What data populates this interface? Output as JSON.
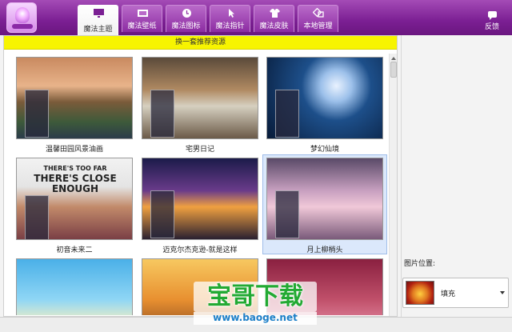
{
  "header": {
    "tabs": [
      {
        "label": "魔法主题",
        "icon": "monitor-icon",
        "active": true
      },
      {
        "label": "魔法壁纸",
        "icon": "wallpaper-icon",
        "active": false
      },
      {
        "label": "魔法图标",
        "icon": "clock-icon",
        "active": false
      },
      {
        "label": "魔法指针",
        "icon": "cursor-icon",
        "active": false
      },
      {
        "label": "魔法皮肤",
        "icon": "shirt-icon",
        "active": false
      },
      {
        "label": "本地管理",
        "icon": "manage-icon",
        "active": false
      }
    ],
    "feedback_label": "反馈"
  },
  "content": {
    "banner_text": "换一套推荐资源",
    "themes": [
      {
        "name": "温馨田园风景油画"
      },
      {
        "name": "宅男日记"
      },
      {
        "name": "梦幻仙境"
      },
      {
        "name": "初音未来二"
      },
      {
        "name": "迈克尔杰克逊-就是这样"
      },
      {
        "name": "月上柳梢头"
      },
      {
        "name": ""
      },
      {
        "name": ""
      },
      {
        "name": ""
      }
    ],
    "selected_index": 5,
    "thumb_text_1": "THERE'S TOO FAR",
    "thumb_text_2": "THERE'S CLOSE ENOUGH"
  },
  "right_panel": {
    "position_label": "图片位置:",
    "position_value": "填充"
  },
  "watermark": {
    "main": "宝哥下载",
    "sub": "www.baoge.net"
  }
}
